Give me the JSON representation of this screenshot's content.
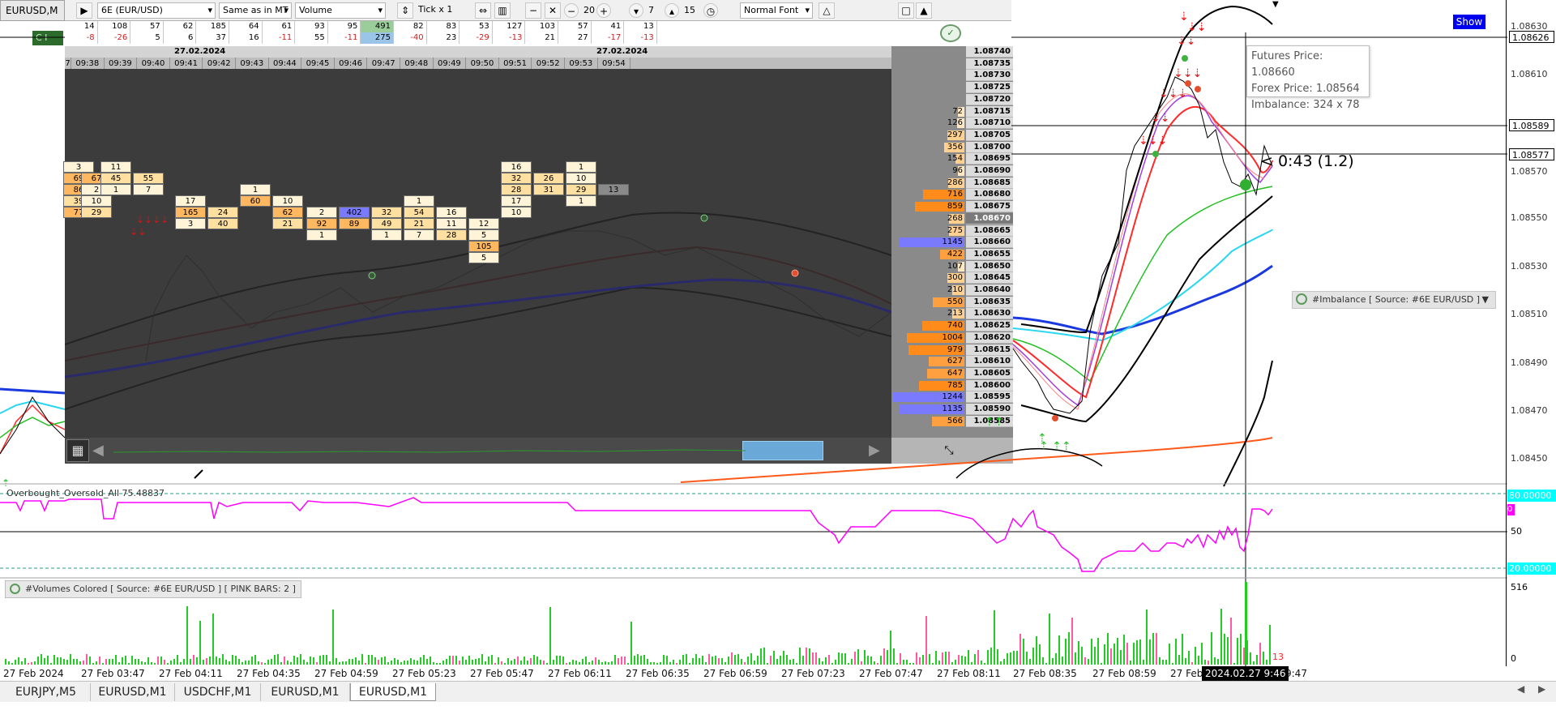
{
  "window": {
    "title": "EURUSD,M"
  },
  "toolbar": {
    "symbol": "6E (EUR/USD)",
    "mode": "Same as in MT",
    "data_type": "Volume",
    "tick": "Tick x 1",
    "zoom_out": "−",
    "close": "✕",
    "val_20": "20",
    "val_7": "7",
    "val_15": "15",
    "font": "Normal Font"
  },
  "delta_rows": {
    "row1": [
      "14",
      "108",
      "57",
      "62",
      "185",
      "64",
      "61",
      "93",
      "95",
      "491",
      "82",
      "83",
      "53",
      "127",
      "103",
      "57",
      "41",
      "13"
    ],
    "row2": [
      "-8",
      "-26",
      "5",
      "6",
      "37",
      "16",
      "-11",
      "55",
      "-11",
      "275",
      "-40",
      "23",
      "-29",
      "-13",
      "21",
      "27",
      "-17",
      "-13"
    ]
  },
  "footprint": {
    "date_left": "27.02.2024",
    "date_right": "27.02.2024",
    "times": [
      "7",
      "09:38",
      "09:39",
      "09:40",
      "09:41",
      "09:42",
      "09:43",
      "09:44",
      "09:45",
      "09:46",
      "09:47",
      "09:48",
      "09:49",
      "09:50",
      "09:51",
      "09:52",
      "09:53",
      "09:54"
    ]
  },
  "ladder": [
    {
      "vol": "",
      "price": "1.08740"
    },
    {
      "vol": "",
      "price": "1.08735"
    },
    {
      "vol": "",
      "price": "1.08730"
    },
    {
      "vol": "",
      "price": "1.08725"
    },
    {
      "vol": "",
      "price": "1.08720"
    },
    {
      "vol": "72",
      "price": "1.08715"
    },
    {
      "vol": "126",
      "price": "1.08710"
    },
    {
      "vol": "297",
      "price": "1.08705"
    },
    {
      "vol": "356",
      "price": "1.08700"
    },
    {
      "vol": "154",
      "price": "1.08695"
    },
    {
      "vol": "96",
      "price": "1.08690"
    },
    {
      "vol": "286",
      "price": "1.08685"
    },
    {
      "vol": "716",
      "price": "1.08680"
    },
    {
      "vol": "859",
      "price": "1.08675"
    },
    {
      "vol": "268",
      "price": "1.08670"
    },
    {
      "vol": "275",
      "price": "1.08665"
    },
    {
      "vol": "1145",
      "price": "1.08660"
    },
    {
      "vol": "422",
      "price": "1.08655"
    },
    {
      "vol": "107",
      "price": "1.08650"
    },
    {
      "vol": "300",
      "price": "1.08645"
    },
    {
      "vol": "210",
      "price": "1.08640"
    },
    {
      "vol": "550",
      "price": "1.08635"
    },
    {
      "vol": "213",
      "price": "1.08630"
    },
    {
      "vol": "740",
      "price": "1.08625"
    },
    {
      "vol": "1004",
      "price": "1.08620"
    },
    {
      "vol": "979",
      "price": "1.08615"
    },
    {
      "vol": "627",
      "price": "1.08610"
    },
    {
      "vol": "647",
      "price": "1.08605"
    },
    {
      "vol": "785",
      "price": "1.08600"
    },
    {
      "vol": "1244",
      "price": "1.08595"
    },
    {
      "vol": "1135",
      "price": "1.08590"
    },
    {
      "vol": "566",
      "price": "1.08585"
    }
  ],
  "price_axis": {
    "labels": [
      "1.08630",
      "1.08610",
      "1.08570",
      "1.08550",
      "1.08530",
      "1.08510",
      "1.08490",
      "1.08470",
      "1.08450"
    ],
    "tag1": "1.08626",
    "tag2": "1.08589",
    "tag3": "1.08577"
  },
  "tooltip": {
    "futures": "Futures Price: 1.08660",
    "forex": "Forex Price: 1.08564",
    "imbalance": "Imbalance: 324 x 78"
  },
  "countdown": "< 0:43 (1.2)",
  "show_button": "Show",
  "imbalance_indicator": "#Imbalance [ Source: #6E EUR/USD ]",
  "oscillator": {
    "label": "Overbought_Oversold_All 75.48837",
    "top_level": "80.00000",
    "mid_value": "0",
    "level50": "50",
    "bottom_level": "20.00000"
  },
  "volumes": {
    "label": "#Volumes Colored [ Source: #6E EUR/USD ]  [ PINK BARS: 2 ]",
    "max": "516",
    "min": "0",
    "last": "13"
  },
  "time_axis": [
    "27 Feb 2024",
    "27 Feb 03:47",
    "27 Feb 04:11",
    "27 Feb 04:35",
    "27 Feb 04:59",
    "27 Feb 05:23",
    "27 Feb 05:47",
    "27 Feb 06:11",
    "27 Feb 06:35",
    "27 Feb 06:59",
    "27 Feb 07:23",
    "27 Feb 07:47",
    "27 Feb 08:11",
    "27 Feb 08:35",
    "27 Feb 08:59",
    "27 Feb",
    "9:47"
  ],
  "cursor_time": "2024.02.27 9:46",
  "tabs": [
    "EURJPY,M5",
    "EURUSD,M1",
    "USDCHF,M1",
    "EURUSD,M1",
    "EURUSD,M1"
  ],
  "colors": {
    "pink_line": "#ff00ff",
    "blue_ma": "#1a3adf",
    "red_ma": "#ff2a2a",
    "green_ma": "#22c022",
    "cyan_ma": "#2ad7f0",
    "orange_ma": "#ff5a1a",
    "panel_bg": "#3c3c3c",
    "ladder_orange": "#ff8c1a",
    "ladder_blue": "#7a7aff"
  }
}
